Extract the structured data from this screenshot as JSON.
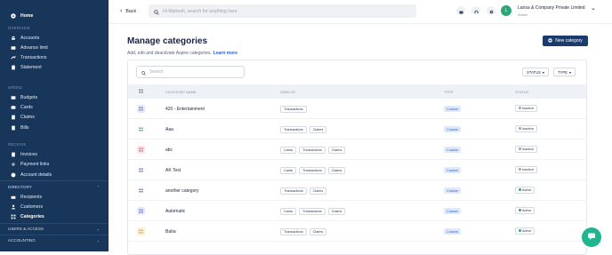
{
  "sidebar": {
    "home": "Home",
    "sections": {
      "overview": "OVERVIEW",
      "spend": "SPEND",
      "receive": "RECEIVE"
    },
    "overview_items": [
      "Accounts",
      "Advance limit",
      "Transactions",
      "Statement"
    ],
    "spend_items": [
      "Budgets",
      "Cards",
      "Claims",
      "Bills"
    ],
    "receive_items": [
      "Invoices",
      "Payment links",
      "Account details"
    ],
    "directory": "DIRECTORY",
    "directory_items": [
      "Recipients",
      "Customers",
      "Categories"
    ],
    "users_access": "USERS & ACCESS",
    "accounting": "ACCOUNTING"
  },
  "topbar": {
    "back_label": "Back",
    "search_placeholder": "Hi Mahesh, search for anything here",
    "company_name": "Larisa & Company Private Limited",
    "role": "Admin",
    "avatar_letter": "L"
  },
  "page": {
    "title": "Manage categories",
    "subtitle": "Add, edit and deactivate Aspire categories.",
    "learn_more": "Learn more",
    "new_category": "New category",
    "search_placeholder": "Search",
    "filter_status": "STATUS",
    "filter_type": "TYPE"
  },
  "table": {
    "headers": {
      "name": "CATEGORY NAME",
      "used_by": "USED BY",
      "type": "TYPE",
      "status": "STATUS"
    },
    "rows": [
      {
        "name": "420 - Entertainment",
        "used_by": [
          "Transactions"
        ],
        "type": "Custom",
        "status": "Inactive",
        "icon_color": "#5566dd",
        "icon_bg": "#e6e8fb"
      },
      {
        "name": "Aaa",
        "used_by": [
          "Transactions",
          "Claims"
        ],
        "type": "Custom",
        "status": "Inactive",
        "icon_color": "#2a9a55",
        "icon_bg": "#ffffff"
      },
      {
        "name": "abc",
        "used_by": [
          "Cards",
          "Transactions",
          "Claims"
        ],
        "type": "Custom",
        "status": "Inactive",
        "icon_color": "#d9506a",
        "icon_bg": "#fbe3e8"
      },
      {
        "name": "AK Test",
        "used_by": [
          "Cards",
          "Transactions",
          "Claims"
        ],
        "type": "Custom",
        "status": "Inactive",
        "icon_color": "#2e5fd0",
        "icon_bg": "#ffffff"
      },
      {
        "name": "another category",
        "used_by": [
          "Transactions",
          "Claims"
        ],
        "type": "Custom",
        "status": "Active",
        "icon_color": "#2e5fd0",
        "icon_bg": "#ffffff"
      },
      {
        "name": "Automatic",
        "used_by": [
          "Cards",
          "Transactions",
          "Claims"
        ],
        "type": "Custom",
        "status": "Active",
        "icon_color": "#5566dd",
        "icon_bg": "#e6e8fb"
      },
      {
        "name": "Baha",
        "used_by": [
          "Transactions",
          "Claims"
        ],
        "type": "Custom",
        "status": "Active",
        "icon_color": "#d9a020",
        "icon_bg": "#fcf0d5"
      }
    ]
  },
  "colors": {
    "sidebar_bg": "#17365a",
    "primary": "#1b3b6f",
    "link": "#2e5fd0",
    "chat": "#1fb58f"
  }
}
